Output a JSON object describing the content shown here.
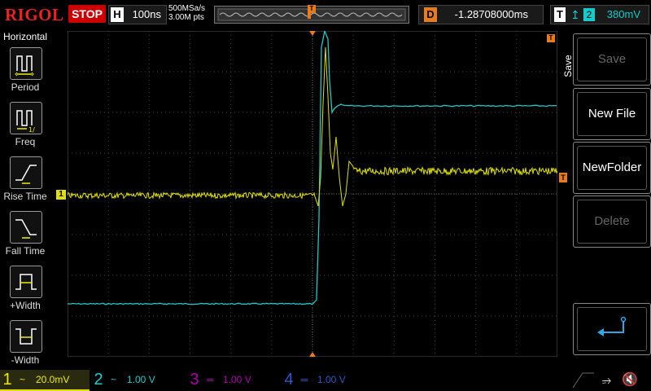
{
  "topbar": {
    "brand": "RIGOL",
    "run_state": "STOP",
    "horizontal": {
      "label": "H",
      "timebase": "100ns"
    },
    "sample_rate": "500MSa/s",
    "memory_depth": "3.00M pts",
    "trigger_marker": "T",
    "delay": {
      "label": "D",
      "value": "-1.28708000ms"
    },
    "trigger": {
      "label": "T",
      "edge": "↥",
      "source": "2",
      "level": "380mV"
    }
  },
  "left_menu": {
    "title": "Horizontal",
    "items": [
      {
        "label": "Period",
        "icon": "period-icon"
      },
      {
        "label": "Freq",
        "icon": "frequency-icon"
      },
      {
        "label": "Rise Time",
        "icon": "rise-time-icon"
      },
      {
        "label": "Fall Time",
        "icon": "fall-time-icon"
      },
      {
        "label": "+Width",
        "icon": "positive-width-icon"
      },
      {
        "label": "-Width",
        "icon": "negative-width-icon"
      }
    ]
  },
  "right_menu": {
    "tab_label": "Save",
    "buttons": [
      {
        "label": "Save",
        "enabled": false
      },
      {
        "label": "New File",
        "enabled": true
      },
      {
        "label": "NewFolder",
        "enabled": true
      },
      {
        "label": "Delete",
        "enabled": false
      },
      {
        "label": "",
        "icon": "return-arrow-icon",
        "enabled": true
      }
    ]
  },
  "markers": {
    "ch1": "1",
    "trig_level": "T",
    "trig_pos": "T"
  },
  "channels": [
    {
      "num": "1",
      "coupling": "~",
      "scale": "20.0mV",
      "active": true,
      "color": "#e0e000"
    },
    {
      "num": "2",
      "coupling": "~",
      "scale": "1.00 V",
      "active": true,
      "color": "#20c8c8"
    },
    {
      "num": "3",
      "coupling": "═",
      "scale": "1.00 V",
      "active": false,
      "color": "#a000a0"
    },
    {
      "num": "4",
      "coupling": "═",
      "scale": "1.00 V",
      "active": false,
      "color": "#3050c0"
    }
  ],
  "status_icons": [
    "usb-icon",
    "speaker-muted-icon"
  ],
  "colors": {
    "accent": "#e87b1c",
    "stop": "#cc0000",
    "ch1": "#e0e000",
    "ch2": "#20c8c8"
  }
}
